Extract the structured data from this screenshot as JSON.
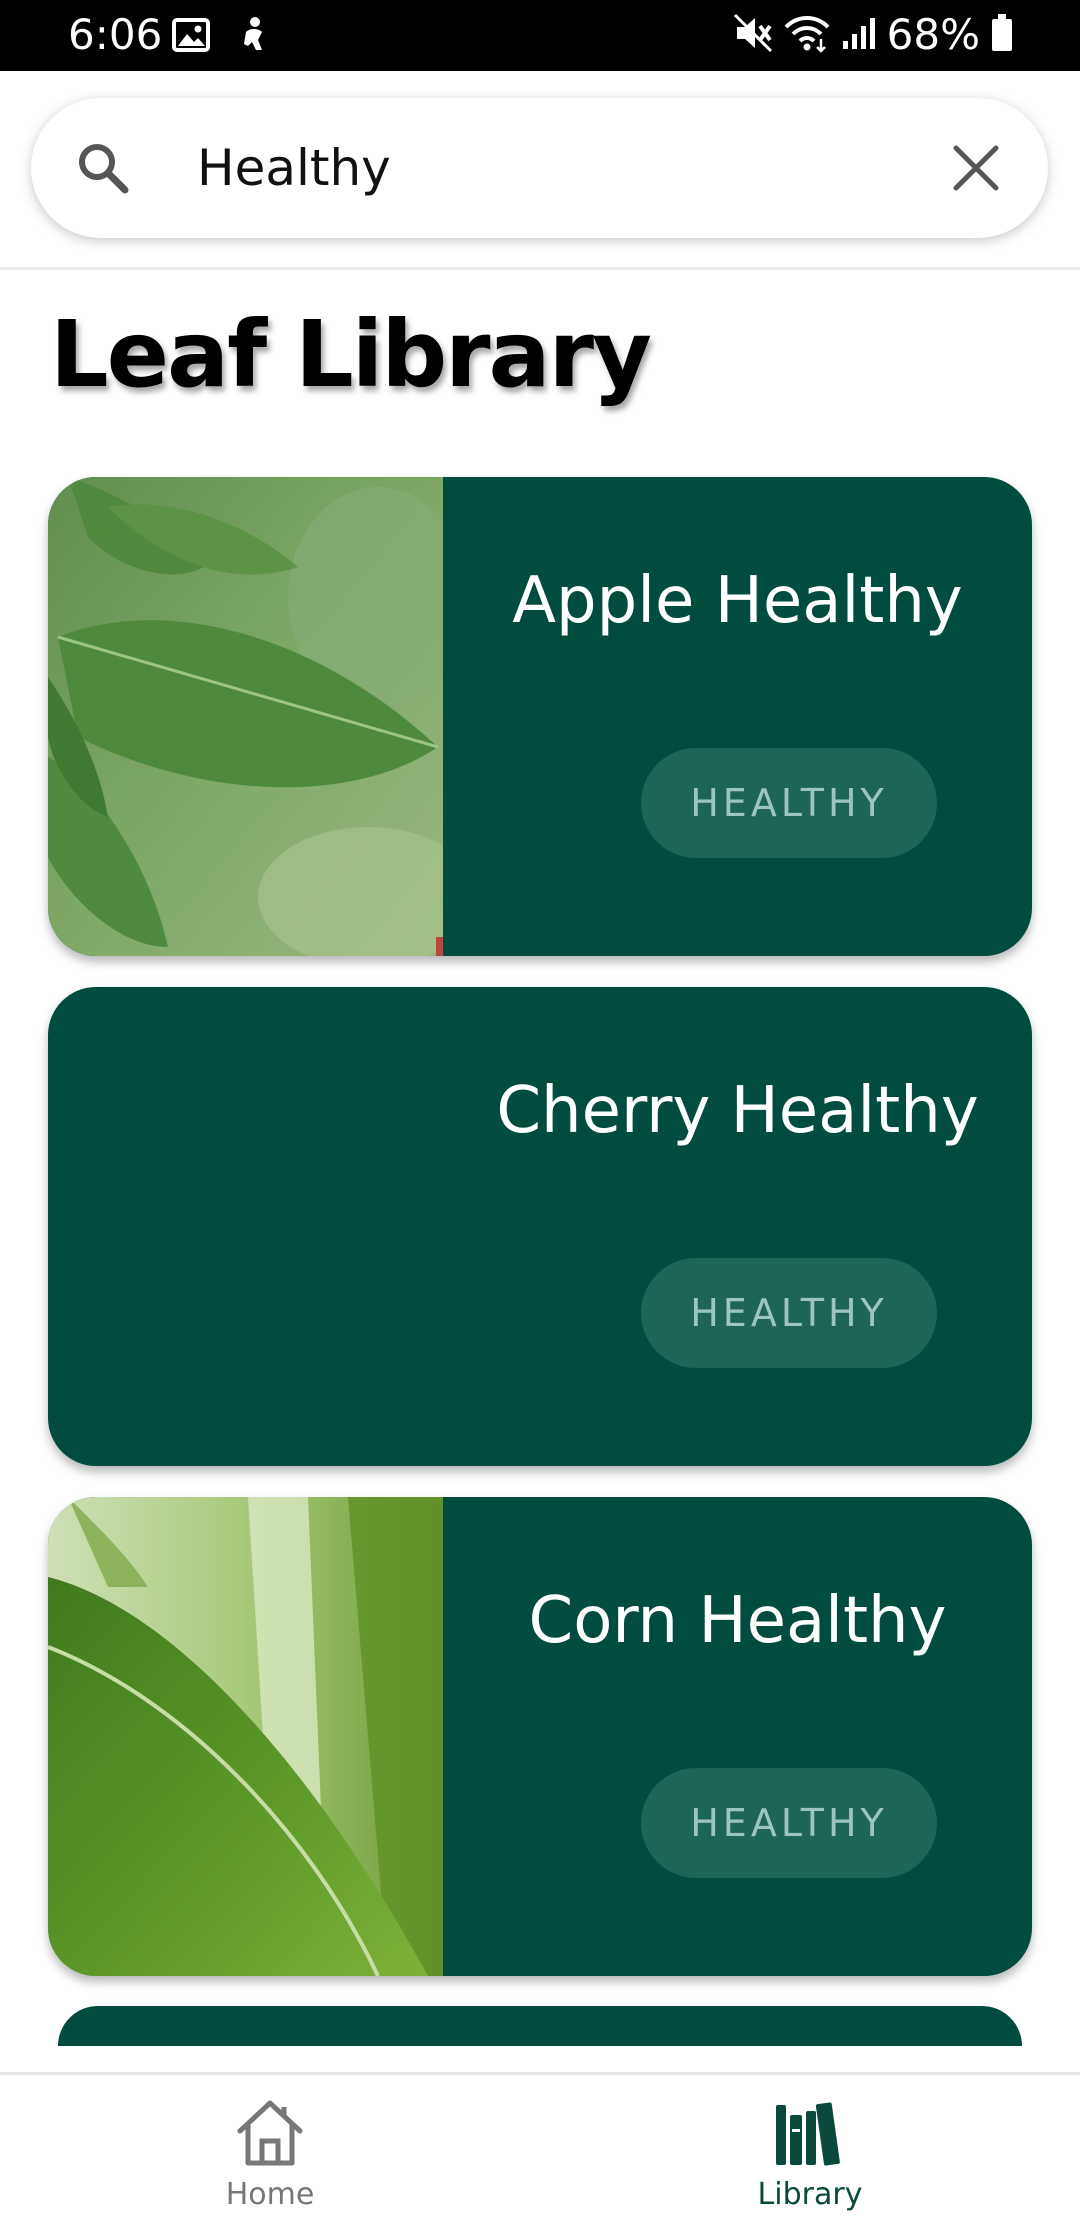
{
  "status_bar": {
    "time": "6:06",
    "battery": "68%"
  },
  "search": {
    "value": "Healthy"
  },
  "title": "Leaf Library",
  "cards": [
    {
      "title": "Apple Healthy",
      "badge": "HEALTHY",
      "image": "apple-leaf-photo"
    },
    {
      "title": "Cherry Healthy",
      "badge": "HEALTHY",
      "image": ""
    },
    {
      "title": "Corn Healthy",
      "badge": "HEALTHY",
      "image": "corn-leaf-photo"
    }
  ],
  "nav": {
    "home": {
      "label": "Home",
      "icon": "home-icon"
    },
    "library": {
      "label": "Library",
      "icon": "library-icon"
    }
  },
  "colors": {
    "card_background": "#004c3f",
    "badge_background": "#1d6556",
    "badge_text": "#9cc6bc",
    "nav_active": "#0a4a3c",
    "nav_inactive": "#777777"
  }
}
